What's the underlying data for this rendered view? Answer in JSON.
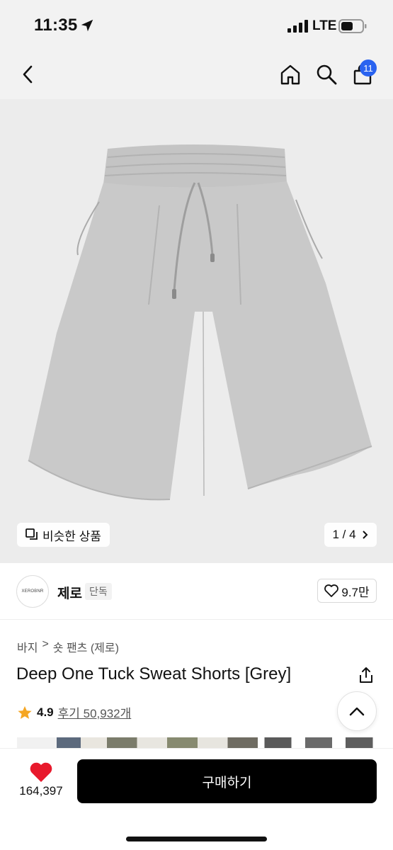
{
  "status_bar": {
    "time": "11:35",
    "network": "LTE"
  },
  "nav": {
    "cart_count": "11",
    "icons": [
      "back-icon",
      "home-icon",
      "search-icon",
      "cart-icon"
    ]
  },
  "gallery": {
    "similar_label": "비슷한 상품",
    "page_indicator": "1 / 4",
    "background_color": "#ececec",
    "product_color": "#c9c9c9"
  },
  "brand": {
    "logo_text": "XEROBNR",
    "name": "제로",
    "exclusive_tag": "단독",
    "likes": "9.7만"
  },
  "product": {
    "breadcrumb": [
      "바지",
      ">",
      "숏 팬츠 (제로)"
    ],
    "title": "Deep One Tuck Sweat Shorts [Grey]",
    "rating": "4.9",
    "reviews": "후기 50,932개"
  },
  "bottom_bar": {
    "heart_count": "164,397",
    "buy_label": "구매하기",
    "accent_color": "#e8192c",
    "badge_color": "#2a63f0"
  }
}
